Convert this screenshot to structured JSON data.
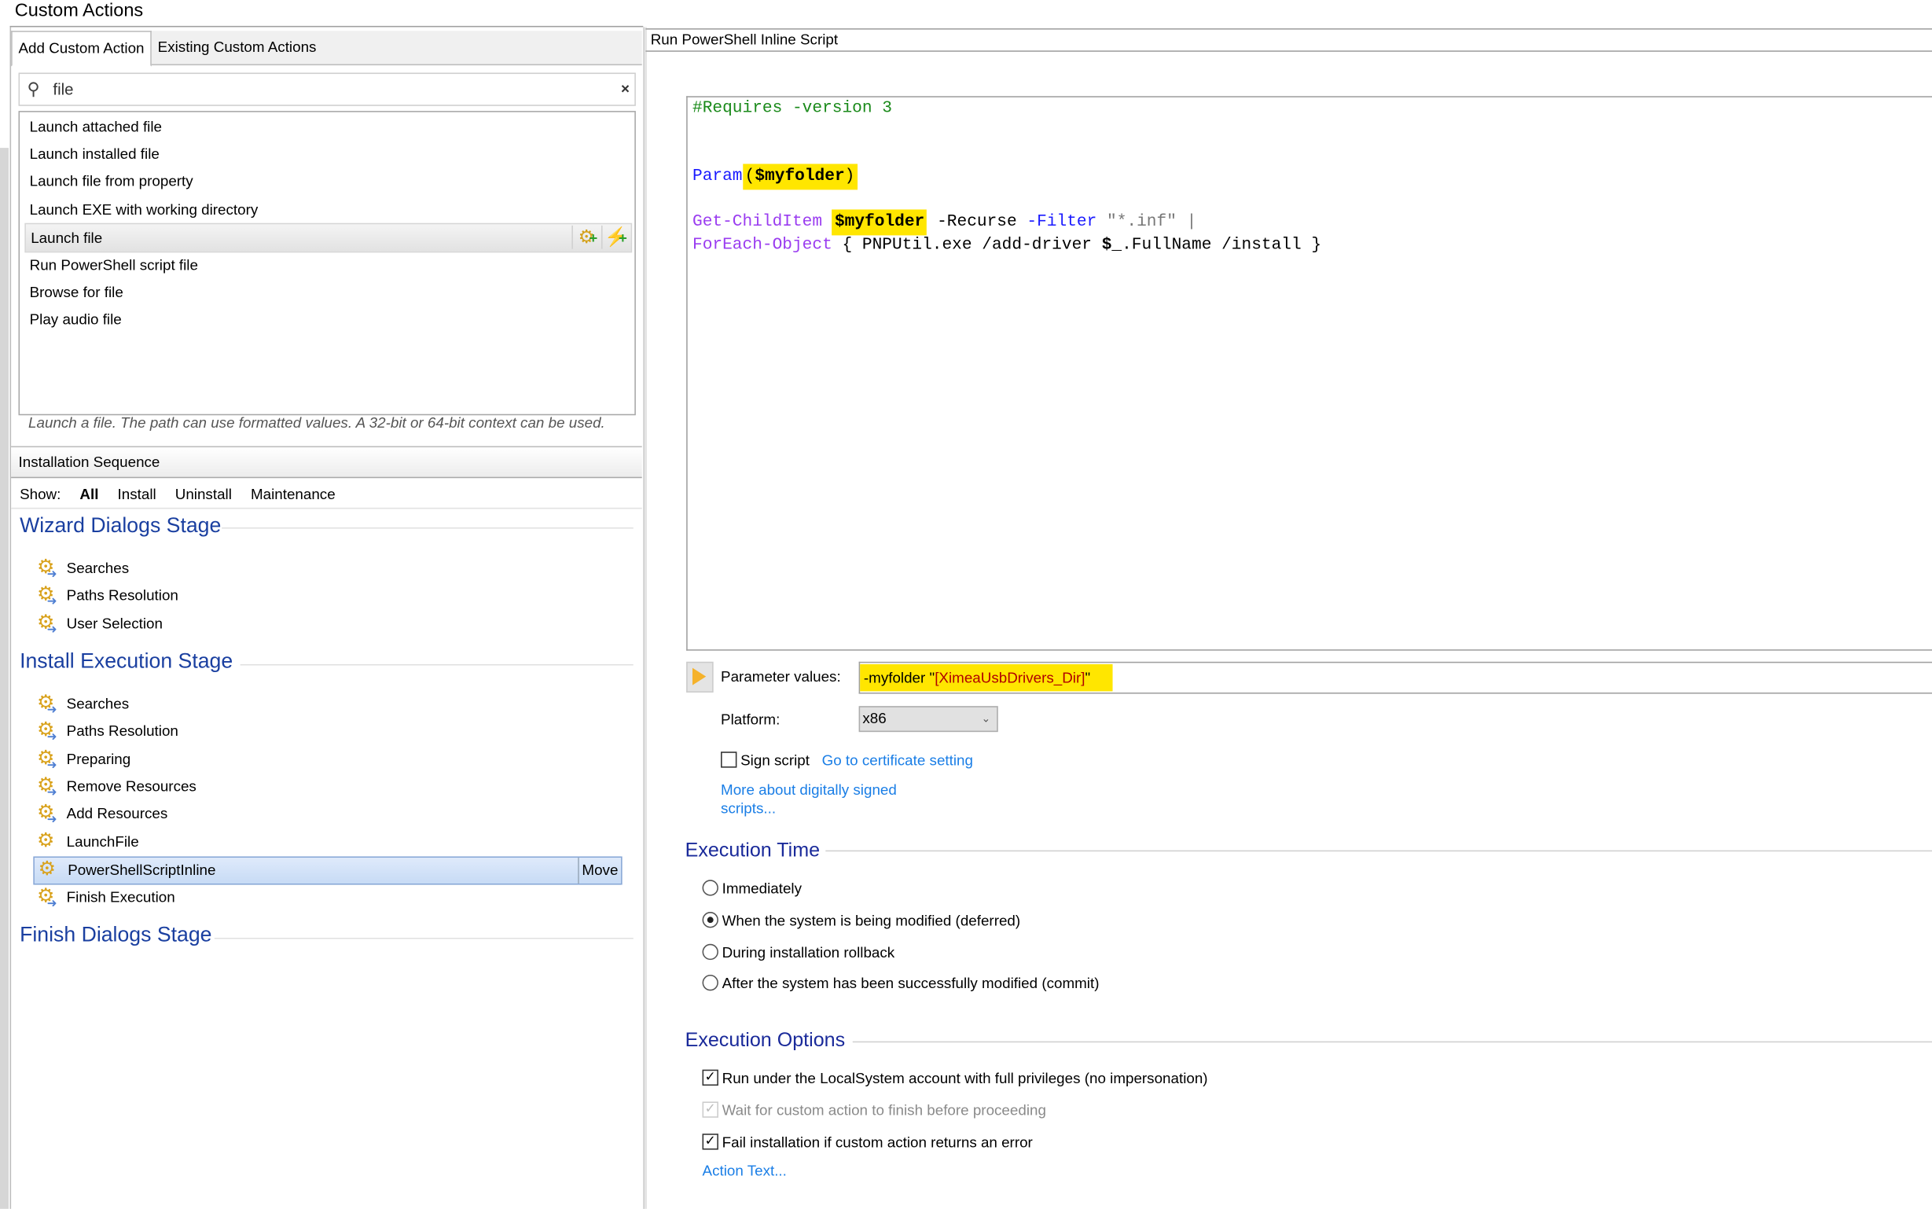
{
  "window": {
    "title": "Custom Actions"
  },
  "left": {
    "tabs": [
      {
        "label": "Add Custom Action",
        "selected": true
      },
      {
        "label": "Existing Custom Actions",
        "selected": false
      }
    ],
    "search": {
      "value": "file",
      "icon": "search-icon",
      "clear": "×"
    },
    "results": [
      {
        "label": "Launch attached file"
      },
      {
        "label": "Launch installed file"
      },
      {
        "label": "Launch file from property"
      },
      {
        "label": "Launch EXE with working directory"
      },
      {
        "label": "Launch file",
        "selected": true
      },
      {
        "label": "Run PowerShell script file"
      },
      {
        "label": "Browse for file"
      },
      {
        "label": "Play audio file"
      }
    ],
    "description": "Launch a file. The path can use formatted values. A 32-bit or 64-bit context can be used."
  },
  "sequence": {
    "header": "Installation Sequence",
    "show_label": "Show:",
    "filters": [
      "All",
      "Install",
      "Uninstall",
      "Maintenance"
    ],
    "active_filter": "All",
    "stages": [
      {
        "title": "Wizard Dialogs Stage",
        "items": [
          "Searches",
          "Paths Resolution",
          "User Selection"
        ]
      },
      {
        "title": "Install Execution Stage",
        "items": [
          "Searches",
          "Paths Resolution",
          "Preparing",
          "Remove Resources",
          "Add Resources",
          "LaunchFile",
          "PowerShellScriptInline",
          "Finish Execution"
        ]
      },
      {
        "title": "Finish Dialogs Stage",
        "items": []
      }
    ],
    "selected_item": "PowerShellScriptInline",
    "move_label": "Move"
  },
  "right": {
    "header": "Run PowerShell Inline Script",
    "code": {
      "line1": "#Requires -version 3",
      "param_kw": "Param",
      "param_open": "(",
      "var": "$myfolder",
      "param_close": ")",
      "gci": "Get-ChildItem",
      "recurse": " -Recurse ",
      "filter": "-Filter",
      "filter_val": " \"*.inf\" |",
      "foreach": "ForEach-Object",
      "foreach_rest": " { PNPUtil.exe /add-driver ",
      "dollar": "$_",
      "foreach_end": ".FullName /install }"
    },
    "params": {
      "label": "Parameter values:",
      "value_prefix": "-myfolder \"",
      "value_ref": "[XimeaUsbDrivers_Dir]",
      "value_suffix": "\""
    },
    "platform": {
      "label": "Platform:",
      "value": "x86"
    },
    "sign_script": {
      "label": "Sign script",
      "checked": false,
      "link": "Go to certificate setting"
    },
    "more_link_1": "More about digitally signed",
    "more_link_2": "scripts...",
    "execution_time": {
      "title": "Execution Time",
      "options": [
        "Immediately",
        "When the system is being modified (deferred)",
        "During installation rollback",
        "After the system has been successfully modified (commit)"
      ],
      "selected": "When the system is being modified (deferred)"
    },
    "execution_options": {
      "title": "Execution Options",
      "options": [
        {
          "label": "Run under the LocalSystem account with full privileges (no impersonation)",
          "checked": true,
          "enabled": true
        },
        {
          "label": "Wait for custom action to finish before proceeding",
          "checked": true,
          "enabled": false
        },
        {
          "label": "Fail installation if custom action returns an error",
          "checked": true,
          "enabled": true
        }
      ],
      "action_text_link": "Action Text..."
    },
    "colors": {
      "highlight": "#ffe600",
      "stage_heading": "#1a3fa0",
      "link": "#1a7ee6"
    }
  }
}
